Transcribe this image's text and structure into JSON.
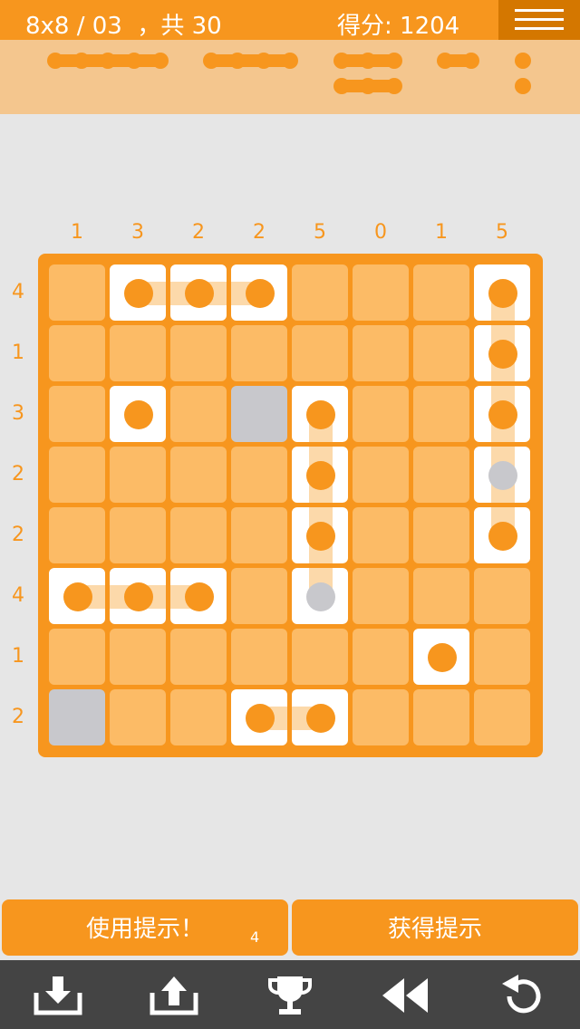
{
  "header": {
    "level_text": "8x8 / 03  ，共 30",
    "score_text": "得分: 1204",
    "menu_icon": "hamburger-menu-icon"
  },
  "fleet": {
    "ships_remaining": [
      5,
      4,
      3,
      3,
      2,
      1,
      1
    ]
  },
  "puzzle": {
    "size": 8,
    "column_clues": [
      "1",
      "3",
      "2",
      "2",
      "5",
      "0",
      "1",
      "5"
    ],
    "row_clues": [
      "4",
      "1",
      "3",
      "2",
      "2",
      "4",
      "1",
      "2"
    ],
    "cells": [
      [
        "W",
        "S:h-start",
        "S:h-mid",
        "S:h-end",
        "W",
        "W",
        "W",
        "S:v-start"
      ],
      [
        "W",
        "W",
        "W",
        "W",
        "W",
        "W",
        "W",
        "S:v-mid"
      ],
      [
        "W",
        "S:single",
        "W",
        "E",
        "S:v-start",
        "W",
        "W",
        "S:v-mid"
      ],
      [
        "W",
        "W",
        "W",
        "W",
        "S:v-mid",
        "W",
        "W",
        "G:v-mid"
      ],
      [
        "W",
        "W",
        "W",
        "W",
        "S:v-mid",
        "W",
        "W",
        "S:v-end"
      ],
      [
        "S:h-start",
        "S:h-mid",
        "S:h-end",
        "W",
        "G:v-end",
        "W",
        "W",
        "W"
      ],
      [
        "W",
        "W",
        "W",
        "W",
        "W",
        "W",
        "S:single",
        "W"
      ],
      [
        "E",
        "W",
        "W",
        "S:h-start",
        "S:h-end",
        "W",
        "W",
        "W"
      ]
    ],
    "colors": {
      "accent": "#f7961e",
      "water": "#fcbb66",
      "ship_bg": "#ffffff",
      "empty": "#c8c8cc",
      "fleet_bar": "#f4c68e",
      "background": "#e6e6e6"
    }
  },
  "actions": {
    "use_hint_label": "使用提示！",
    "hint_count": "4",
    "get_hint_label": "获得提示"
  },
  "toolbar": {
    "icons": [
      "download-icon",
      "upload-icon",
      "trophy-icon",
      "rewind-icon",
      "undo-icon"
    ]
  }
}
